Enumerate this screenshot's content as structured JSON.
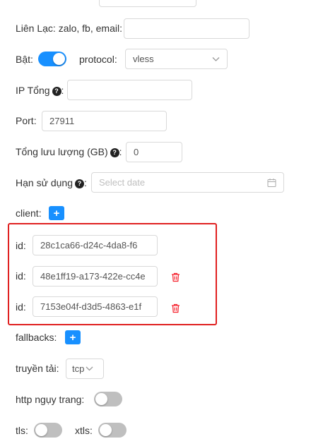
{
  "form": {
    "contact_label": "Liên Lạc: zalo, fb, email",
    "contact_value": "",
    "enable_label": "Bật",
    "enable_on": true,
    "protocol_label": "protocol",
    "protocol_value": "vless",
    "ip_label": "IP Tổng",
    "ip_value": "",
    "port_label": "Port",
    "port_value": "27911",
    "total_traffic_label": "Tổng lưu lượng (GB)",
    "total_traffic_value": "0",
    "expiry_label": "Hạn sử dụng",
    "expiry_placeholder": "Select date",
    "client_label": "client",
    "clients": [
      {
        "id_label": "id",
        "id_value": "28c1ca66-d24c-4da8-f6",
        "deletable": false
      },
      {
        "id_label": "id",
        "id_value": "48e1ff19-a173-422e-cc4e",
        "deletable": true
      },
      {
        "id_label": "id",
        "id_value": "7153e04f-d3d5-4863-e1f",
        "deletable": true
      }
    ],
    "fallbacks_label": "fallbacks",
    "transport_label": "truyền tải",
    "transport_value": "tcp",
    "http_disguise_label": "http ngụy trang",
    "http_disguise_on": false,
    "tls_label": "tls",
    "tls_on": false,
    "xtls_label": "xtls",
    "xtls_on": false
  },
  "colors": {
    "accent": "#1890ff",
    "highlight_border": "#e02020",
    "delete_icon": "#f5222d"
  },
  "icons": {
    "help": "question-circle-icon",
    "calendar": "calendar-icon",
    "delete": "trash-icon",
    "plus": "plus-icon",
    "chevron": "chevron-down-icon"
  }
}
